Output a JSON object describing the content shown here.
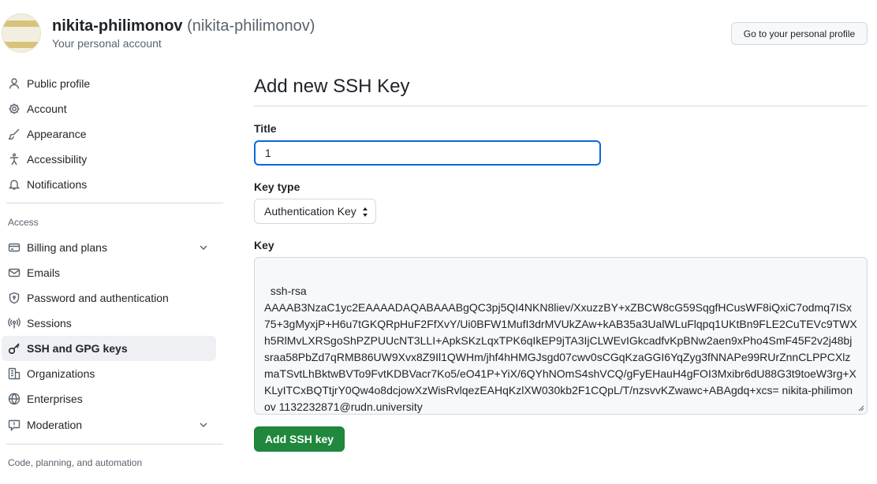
{
  "header": {
    "display_name": "nikita-philimonov",
    "handle": "(nikita-philimonov)",
    "subtitle": "Your personal account",
    "profile_button_label": "Go to your personal profile"
  },
  "sidebar": {
    "items": [
      {
        "label": "Public profile",
        "icon": "person-icon"
      },
      {
        "label": "Account",
        "icon": "gear-icon"
      },
      {
        "label": "Appearance",
        "icon": "paintbrush-icon"
      },
      {
        "label": "Accessibility",
        "icon": "accessibility-icon"
      },
      {
        "label": "Notifications",
        "icon": "bell-icon"
      }
    ],
    "access_label": "Access",
    "access_items": [
      {
        "label": "Billing and plans",
        "icon": "credit-card-icon",
        "expandable": true
      },
      {
        "label": "Emails",
        "icon": "mail-icon"
      },
      {
        "label": "Password and authentication",
        "icon": "shield-lock-icon"
      },
      {
        "label": "Sessions",
        "icon": "broadcast-icon"
      },
      {
        "label": "SSH and GPG keys",
        "icon": "key-icon",
        "active": true
      },
      {
        "label": "Organizations",
        "icon": "organization-icon"
      },
      {
        "label": "Enterprises",
        "icon": "globe-icon"
      },
      {
        "label": "Moderation",
        "icon": "report-icon",
        "expandable": true
      }
    ],
    "code_section_label": "Code, planning, and automation"
  },
  "main": {
    "title": "Add new SSH Key",
    "title_field_label": "Title",
    "title_value": "1",
    "key_type_label": "Key type",
    "key_type_value": "Authentication Key",
    "key_label": "Key",
    "key_value": "ssh-rsa\nAAAAB3NzaC1yc2EAAAADAQABAAABgQC3pj5QI4NKN8liev/XxuzzBY+xZBCW8cG59SqgfHCusWF8iQxiC7odmq7ISx75+3gMyxjP+H6u7tGKQRpHuF2FfXvY/Ui0BFW1MufI3drMVUkZAw+kAB35a3UalWLuFlqpq1UKtBn9FLE2CuTEVc9TWXh5RlMvLXRSgoShPZPUUcNT3LLI+ApkSKzLqxTPK6qIkEP9jTA3IjCLWEvIGkcadfvKpBNw2aen9xPho4SmF45F2v2j48bjsraa58PbZd7qRMB86UW9Xvx8Z9Il1QWHm/jhf4hHMGJsgd07cwv0sCGqKzaGGI6YqZyg3fNNAPe99RUrZnnCLPPCXlzmaTSvtLhBktwBVTo9FvtKDBVacr7Ko5/eO41P+YiX/6QYhNOmS4shVCQ/gFyEHauH4gFOI3Mxibr6dU88G3t9toeW3rg+XKLyITCxBQTtjrY0Qw4o8dcjowXzWisRvlqezEAHqKzlXW030kb2F1CQpL/T/nzsvvKZwawc+ABAgdq+xcs= nikita-philimonov 1132232871@rudn.university",
    "submit_label": "Add SSH key"
  },
  "colors": {
    "accent": "#0969da",
    "primary_button": "#1f883d",
    "muted_text": "#59636e",
    "border": "#d1d9e0"
  }
}
